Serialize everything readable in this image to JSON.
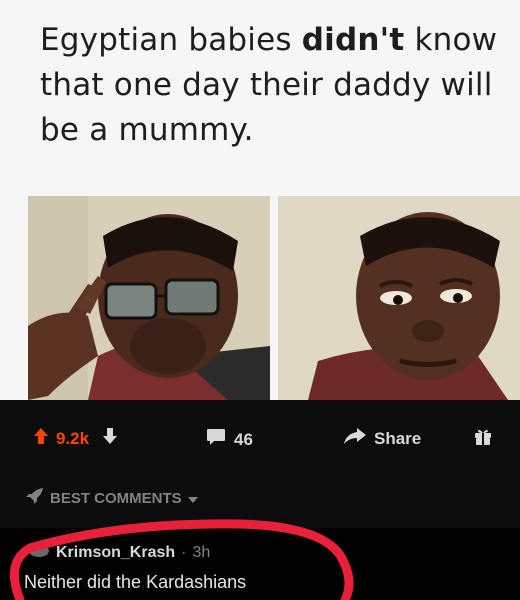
{
  "meme": {
    "caption_part1": "Egyptian babies ",
    "caption_bold": "didn't",
    "caption_part2": " know that one day their daddy will be a mummy."
  },
  "actions": {
    "upvotes": "9.2k",
    "comments": "46",
    "share_label": "Share",
    "icons": [
      "upvote-icon",
      "downvote-icon",
      "comment-icon",
      "share-icon",
      "gift-icon"
    ]
  },
  "sort": {
    "label": "BEST COMMENTS",
    "icons": [
      "rocket-icon",
      "caret-down-icon"
    ]
  },
  "comment": {
    "username": "Krimson_Krash",
    "separator": "·",
    "time": "3h",
    "text": "Neither did the Kardashians"
  },
  "colors": {
    "upvote": "#ff4500",
    "annotation_red": "#e8203a",
    "text_muted": "#818384"
  }
}
